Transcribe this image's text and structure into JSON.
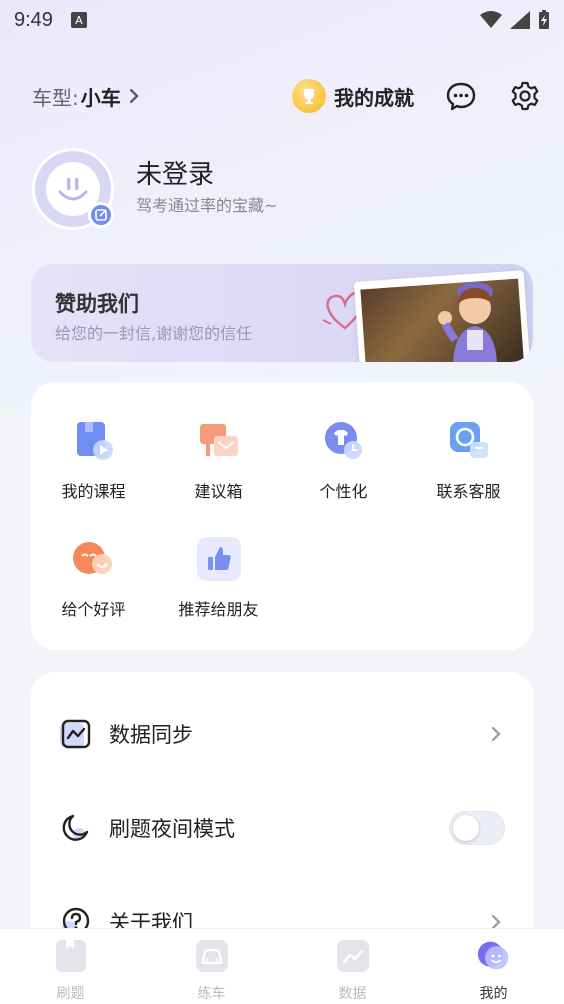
{
  "status_bar": {
    "time": "9:49",
    "notif_badge": "A"
  },
  "header": {
    "car_type_label": "车型:",
    "car_type_value": "小车",
    "achievement": "我的成就"
  },
  "profile": {
    "name": "未登录",
    "subtitle": "驾考通过率的宝藏~"
  },
  "sponsor": {
    "title": "赞助我们",
    "subtitle": "给您的一封信,谢谢您的信任"
  },
  "grid_items": [
    {
      "label": "我的课程",
      "icon": "course-icon",
      "color": "#6f8df4"
    },
    {
      "label": "建议箱",
      "icon": "suggestion-icon",
      "color": "#f59a7a"
    },
    {
      "label": "个性化",
      "icon": "personalize-icon",
      "color": "#7a8cf0"
    },
    {
      "label": "联系客服",
      "icon": "service-icon",
      "color": "#6aa0f2"
    },
    {
      "label": "给个好评",
      "icon": "rate-icon",
      "color": "#f5885a"
    },
    {
      "label": "推荐给朋友",
      "icon": "thumbs-up-icon",
      "color": "#7a90f0"
    }
  ],
  "list": [
    {
      "label": "数据同步",
      "icon": "sync-icon",
      "control": "chevron"
    },
    {
      "label": "刷题夜间模式",
      "icon": "moon-icon",
      "control": "toggle",
      "toggle_on": false
    },
    {
      "label": "关于我们",
      "icon": "question-icon",
      "control": "chevron"
    }
  ],
  "tabs": [
    {
      "label": "刷题",
      "icon": "practice-icon",
      "active": false
    },
    {
      "label": "练车",
      "icon": "car-icon",
      "active": false
    },
    {
      "label": "数据",
      "icon": "chart-icon",
      "active": false
    },
    {
      "label": "我的",
      "icon": "profile-icon",
      "active": true
    }
  ],
  "colors": {
    "accent": "#6f8df4",
    "trophy": "#f5b623"
  }
}
